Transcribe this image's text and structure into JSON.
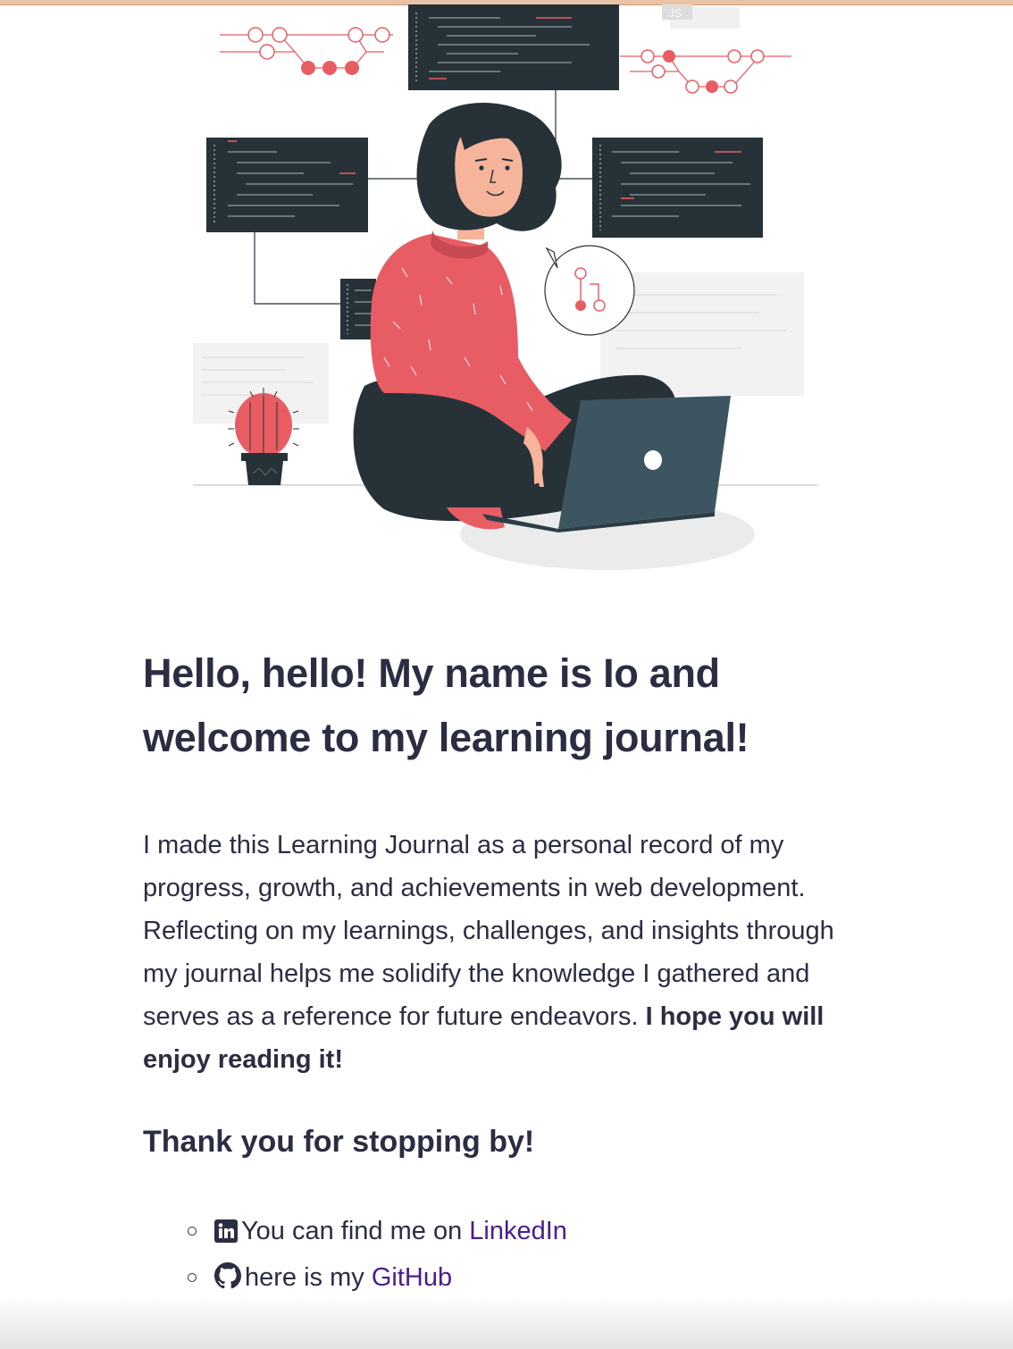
{
  "hero": {
    "illustration_icon": "woman-coding-laptop-illustration",
    "js_badge": "JS",
    "colors": {
      "accent": "#e85d64",
      "dark": "#263238",
      "laptop": "#3d5560",
      "skin": "#f6b49a"
    }
  },
  "intro": {
    "heading_line1": "Hello, hello! My name is Io and",
    "heading_line2": "welcome to my learning journal!",
    "paragraph": "I made this Learning Journal as a personal record of my progress, growth, and achievements in web development. Reflecting on my learnings, challenges, and insights through my journal helps me solidify the knowledge I gathered and serves as a reference for future endeavors.",
    "paragraph_bold": "I hope you will enjoy reading it!"
  },
  "thanks": {
    "heading": "Thank you for stopping by!"
  },
  "links": [
    {
      "icon": "linkedin-icon",
      "text": "You can find me on ",
      "link_label": "LinkedIn"
    },
    {
      "icon": "github-icon",
      "text": "here is my ",
      "link_label": "GitHub"
    }
  ],
  "colors": {
    "text": "#2b2d42",
    "link": "#4b1d8c"
  }
}
